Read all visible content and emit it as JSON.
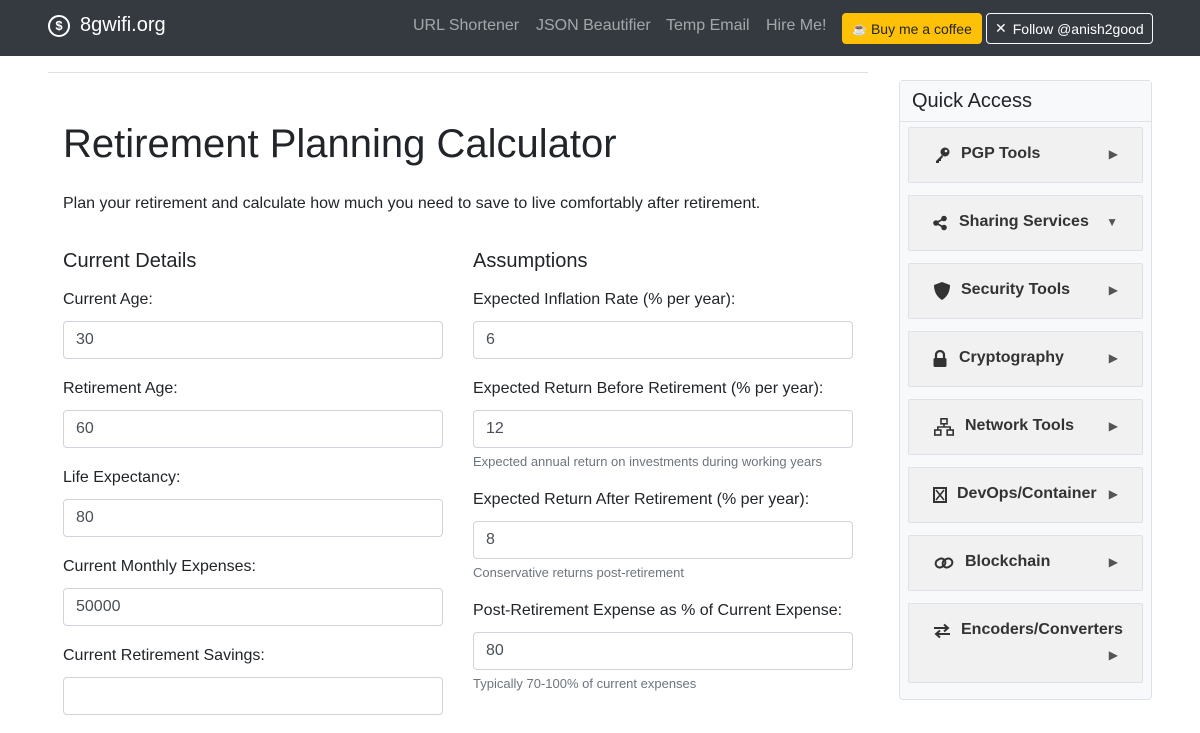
{
  "navbar": {
    "brand": "8gwifi.org",
    "links": [
      "URL Shortener",
      "JSON Beautifier",
      "Temp Email",
      "Hire Me!"
    ],
    "coffee_button": "Buy me a coffee",
    "follow_button": "Follow @anish2good"
  },
  "main": {
    "title": "Retirement Planning Calculator",
    "lead": "Plan your retirement and calculate how much you need to save to live comfortably after retirement.",
    "current": {
      "heading": "Current Details",
      "current_age": {
        "label": "Current Age:",
        "value": "30"
      },
      "retirement_age": {
        "label": "Retirement Age:",
        "value": "60"
      },
      "life_expectancy": {
        "label": "Life Expectancy:",
        "value": "80"
      },
      "monthly_expenses": {
        "label": "Current Monthly Expenses:",
        "value": "50000"
      },
      "savings": {
        "label": "Current Retirement Savings:",
        "value": ""
      }
    },
    "assumptions": {
      "heading": "Assumptions",
      "inflation": {
        "label": "Expected Inflation Rate (% per year):",
        "value": "6"
      },
      "return_before": {
        "label": "Expected Return Before Retirement (% per year):",
        "value": "12",
        "help": "Expected annual return on investments during working years"
      },
      "return_after": {
        "label": "Expected Return After Retirement (% per year):",
        "value": "8",
        "help": "Conservative returns post-retirement"
      },
      "expense_pct": {
        "label": "Post-Retirement Expense as % of Current Expense:",
        "value": "80",
        "help": "Typically 70-100% of current expenses"
      }
    }
  },
  "sidebar": {
    "title": "Quick Access",
    "items": [
      {
        "label": "PGP Tools",
        "icon": "key-icon",
        "arrow": "▶"
      },
      {
        "label": "Sharing Services",
        "icon": "share-icon",
        "arrow": "▼"
      },
      {
        "label": "Security Tools",
        "icon": "shield-icon",
        "arrow": "▶"
      },
      {
        "label": "Cryptography",
        "icon": "lock-icon",
        "arrow": "▶"
      },
      {
        "label": "Network Tools",
        "icon": "network-icon",
        "arrow": "▶"
      },
      {
        "label": "DevOps/Container",
        "icon": "container-icon",
        "arrow": "▶"
      },
      {
        "label": "Blockchain",
        "icon": "link-icon",
        "arrow": "▶"
      },
      {
        "label": "Encoders/Converters",
        "icon": "exchange-icon",
        "arrow": "▶"
      }
    ]
  }
}
